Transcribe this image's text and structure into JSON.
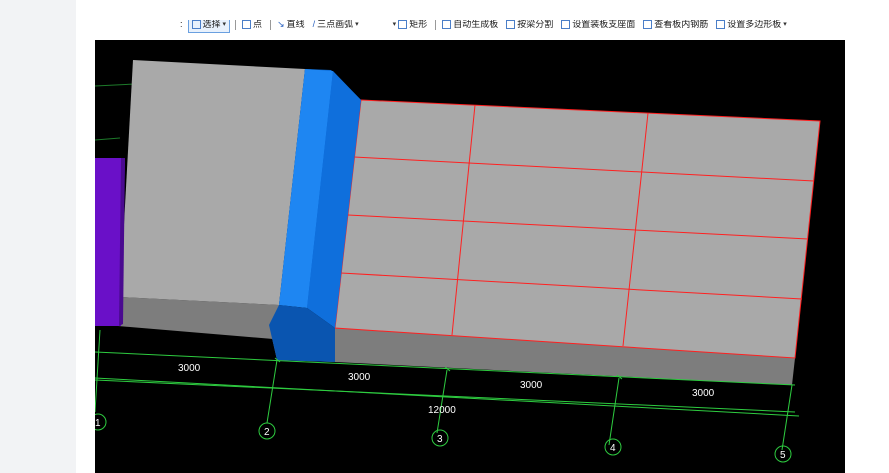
{
  "toolbar": {
    "items": [
      {
        "label": "选择",
        "icon": "pointer-icon",
        "active": true,
        "dropdown": true
      },
      {
        "label": "点",
        "icon": "point-icon"
      },
      {
        "label": "直线",
        "icon": "line-icon"
      },
      {
        "label": "三点画弧",
        "icon": "arc-icon",
        "dropdown": true
      },
      {
        "label": "矩形",
        "icon": "rectangle-icon"
      },
      {
        "label": "自动生成板",
        "icon": "auto-slab-icon"
      },
      {
        "label": "按梁分割",
        "icon": "split-by-beam-icon"
      },
      {
        "label": "设置装板支座面",
        "icon": "support-face-icon"
      },
      {
        "label": "查看板内钢筋",
        "icon": "view-rebar-icon"
      },
      {
        "label": "设置多边形板",
        "icon": "polygon-slab-icon",
        "dropdown": true
      }
    ]
  },
  "viewport": {
    "dimensions": [
      "3000",
      "3000",
      "3000",
      "3000"
    ],
    "total_dimension": "12000",
    "axis_labels": [
      "1",
      "2",
      "3",
      "4",
      "5"
    ]
  },
  "colors": {
    "background": "#000000",
    "slab": "#a9a9a9",
    "slab_side": "#7d7d7d",
    "beam": "#1177e8",
    "column": "#6a10c8",
    "grid_red": "#ff2020",
    "axis_green": "#2ecc40"
  }
}
